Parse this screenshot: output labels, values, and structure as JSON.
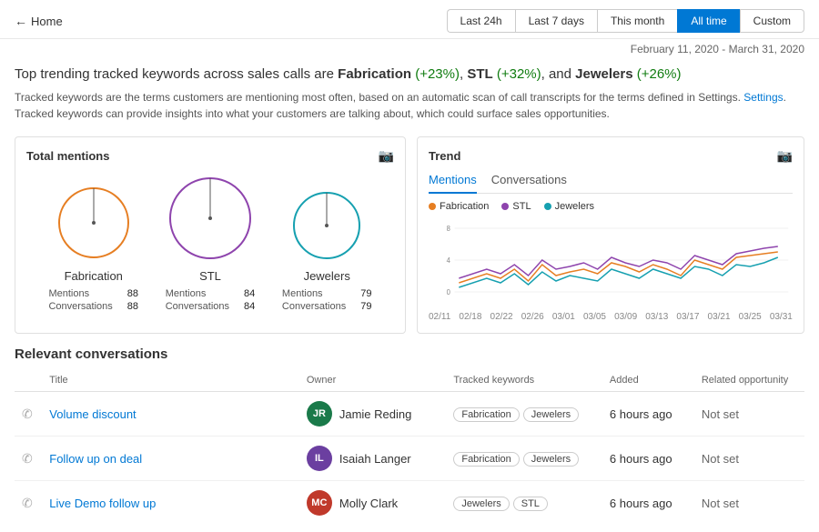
{
  "header": {
    "back_label": "Home",
    "filters": [
      "Last 24h",
      "Last 7 days",
      "This month",
      "All time",
      "Custom"
    ],
    "active_filter": "All time",
    "date_range": "February 11, 2020 - March 31, 2020"
  },
  "headline": {
    "text_prefix": "Top trending tracked keywords across sales calls are ",
    "keyword1": "Fabrication",
    "keyword1_change": "(+23%)",
    "keyword2": "STL",
    "keyword2_change": "(+32%)",
    "keyword3": "Jewelers",
    "keyword3_change": "(+26%)"
  },
  "subtext": {
    "line1": "Tracked keywords are the terms customers are mentioning most often, based on an automatic scan of call transcripts for the terms defined in Settings.",
    "line2": "Tracked keywords can provide insights into what your customers are talking about, which could surface sales opportunities."
  },
  "total_mentions": {
    "title": "Total mentions",
    "items": [
      {
        "name": "Fabrication",
        "mentions": 88,
        "conversations": 88,
        "color": "#e67e22",
        "radius": 45
      },
      {
        "name": "STL",
        "mentions": 84,
        "conversations": 84,
        "color": "#8e44ad",
        "radius": 50
      },
      {
        "name": "Jewelers",
        "mentions": 79,
        "conversations": 79,
        "color": "#16a0b0",
        "radius": 42
      }
    ]
  },
  "trend": {
    "title": "Trend",
    "tabs": [
      "Mentions",
      "Conversations"
    ],
    "active_tab": "Mentions",
    "legend": [
      {
        "label": "Fabrication",
        "color": "#e67e22"
      },
      {
        "label": "STL",
        "color": "#8e44ad"
      },
      {
        "label": "Jewelers",
        "color": "#16a0b0"
      }
    ],
    "y_labels": [
      "8",
      "4",
      "0"
    ],
    "x_labels": [
      "02/11",
      "02/18",
      "02/22",
      "02/26",
      "03/01",
      "03/05",
      "03/09",
      "03/13",
      "03/17",
      "03/21",
      "03/25",
      "03/31"
    ]
  },
  "conversations": {
    "title": "Relevant conversations",
    "columns": [
      "Title",
      "Owner",
      "Tracked keywords",
      "Added",
      "Related opportunity"
    ],
    "rows": [
      {
        "title": "Volume discount",
        "owner_name": "Jamie Reding",
        "owner_initials": "JR",
        "owner_color": "#1a7a4a",
        "keywords": [
          "Fabrication",
          "Jewelers"
        ],
        "added": "6 hours ago",
        "related": "Not set"
      },
      {
        "title": "Follow up on deal",
        "owner_name": "Isaiah Langer",
        "owner_initials": "IL",
        "owner_color": "#6b3fa0",
        "keywords": [
          "Fabrication",
          "Jewelers"
        ],
        "added": "6 hours ago",
        "related": "Not set"
      },
      {
        "title": "Live Demo follow up",
        "owner_name": "Molly Clark",
        "owner_initials": "MC",
        "owner_color": "#c0392b",
        "keywords": [
          "Jewelers",
          "STL"
        ],
        "added": "6 hours ago",
        "related": "Not set"
      }
    ]
  }
}
